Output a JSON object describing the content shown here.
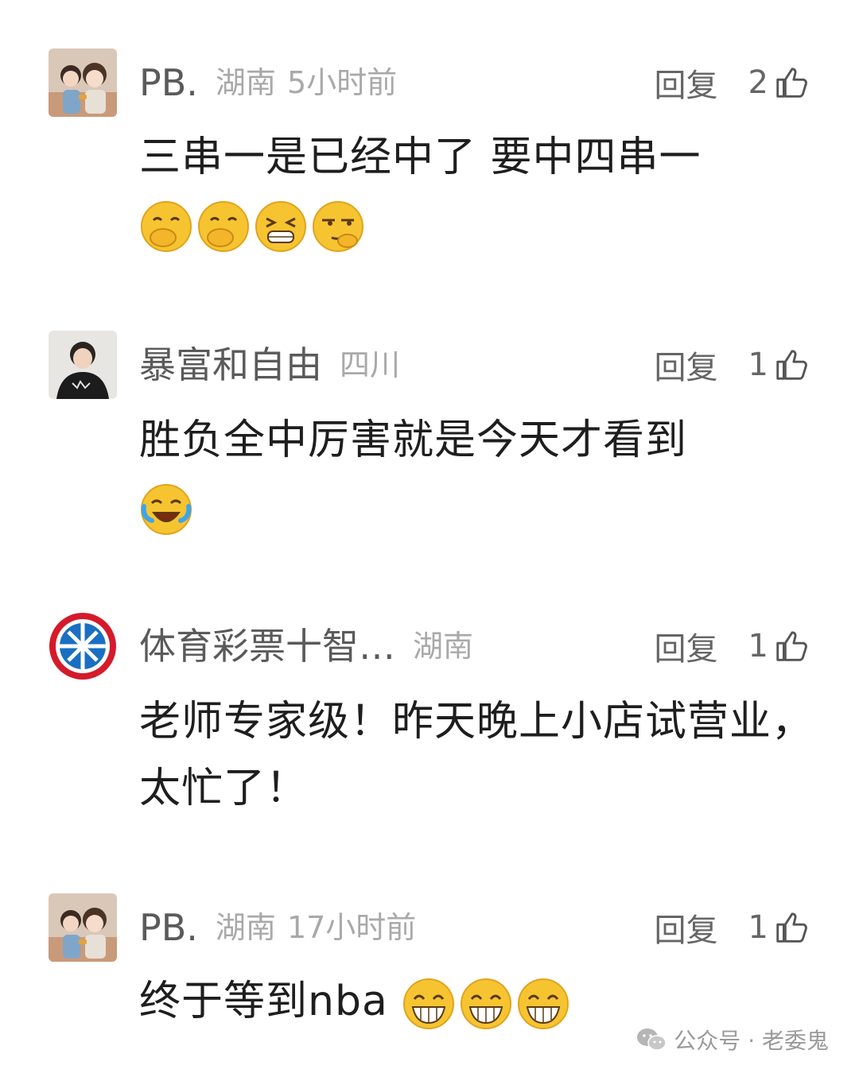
{
  "comments": [
    {
      "username": "PB.",
      "location": "湖南",
      "time": "5小时前",
      "reply_label": "回复",
      "likes": "2",
      "text": "三串一是已经中了 要中四串一",
      "avatar_icon": "couple-photo-avatar",
      "emojis": [
        "covering-mouth-emoji",
        "covering-mouth-emoji",
        "grinning-squint-emoji",
        "smirk-emoji"
      ]
    },
    {
      "username": "暴富和自由",
      "location": "四川",
      "time": "",
      "reply_label": "回复",
      "likes": "1",
      "text": "胜负全中厉害就是今天才看到",
      "avatar_icon": "person-hoodie-avatar",
      "emojis": [
        "laughing-crying-emoji"
      ]
    },
    {
      "username": "体育彩票十智…",
      "location": "湖南",
      "time": "",
      "reply_label": "回复",
      "likes": "1",
      "text": "老师专家级！昨天晚上小店试营业，太忙了！",
      "avatar_icon": "fc-bayern-logo-avatar",
      "emojis": []
    },
    {
      "username": "PB.",
      "location": "湖南",
      "time": "17小时前",
      "reply_label": "回复",
      "likes": "1",
      "text": "终于等到nba",
      "avatar_icon": "couple-photo-avatar",
      "emojis": [
        "big-grin-emoji",
        "big-grin-emoji",
        "big-grin-emoji"
      ]
    }
  ],
  "watermark": {
    "text": "公众号 · 老委鬼",
    "icon": "wechat-icon"
  },
  "colors": {
    "username": "#5a5a5a",
    "meta": "#a9a9a9",
    "body": "#1e1e1e",
    "emoji": "#f7c431"
  }
}
